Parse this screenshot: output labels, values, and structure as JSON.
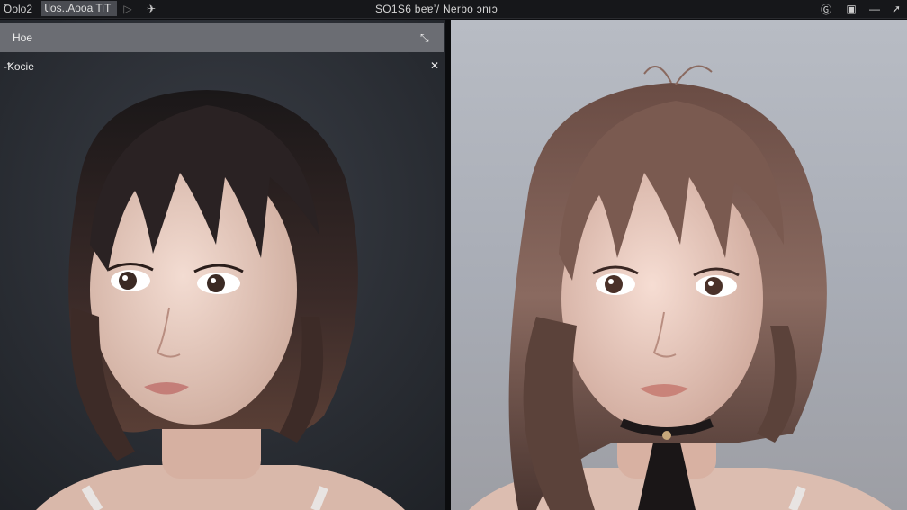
{
  "topbar": {
    "menu_left": "Ꝺolo2",
    "menu_active": "Ꙇlos..Aooa TiT",
    "title": "SO1S6 beɐʼ/ Nerbo ɔnıɔ",
    "icons": [
      "play-icon",
      "send-icon",
      "circle-g-icon",
      "window-icon",
      "minimize-icon",
      "close-icon"
    ]
  },
  "left_panel": {
    "header_label": "Hoe",
    "sub_label": "-Ꝁoᴄie",
    "image": "portrait-left"
  },
  "right_panel": {
    "image": "portrait-right"
  },
  "colors": {
    "topbar": "#16171a",
    "panel_header": "#6b6d73",
    "left_bg": "#25282e",
    "right_bg": "#b8bcc4"
  }
}
